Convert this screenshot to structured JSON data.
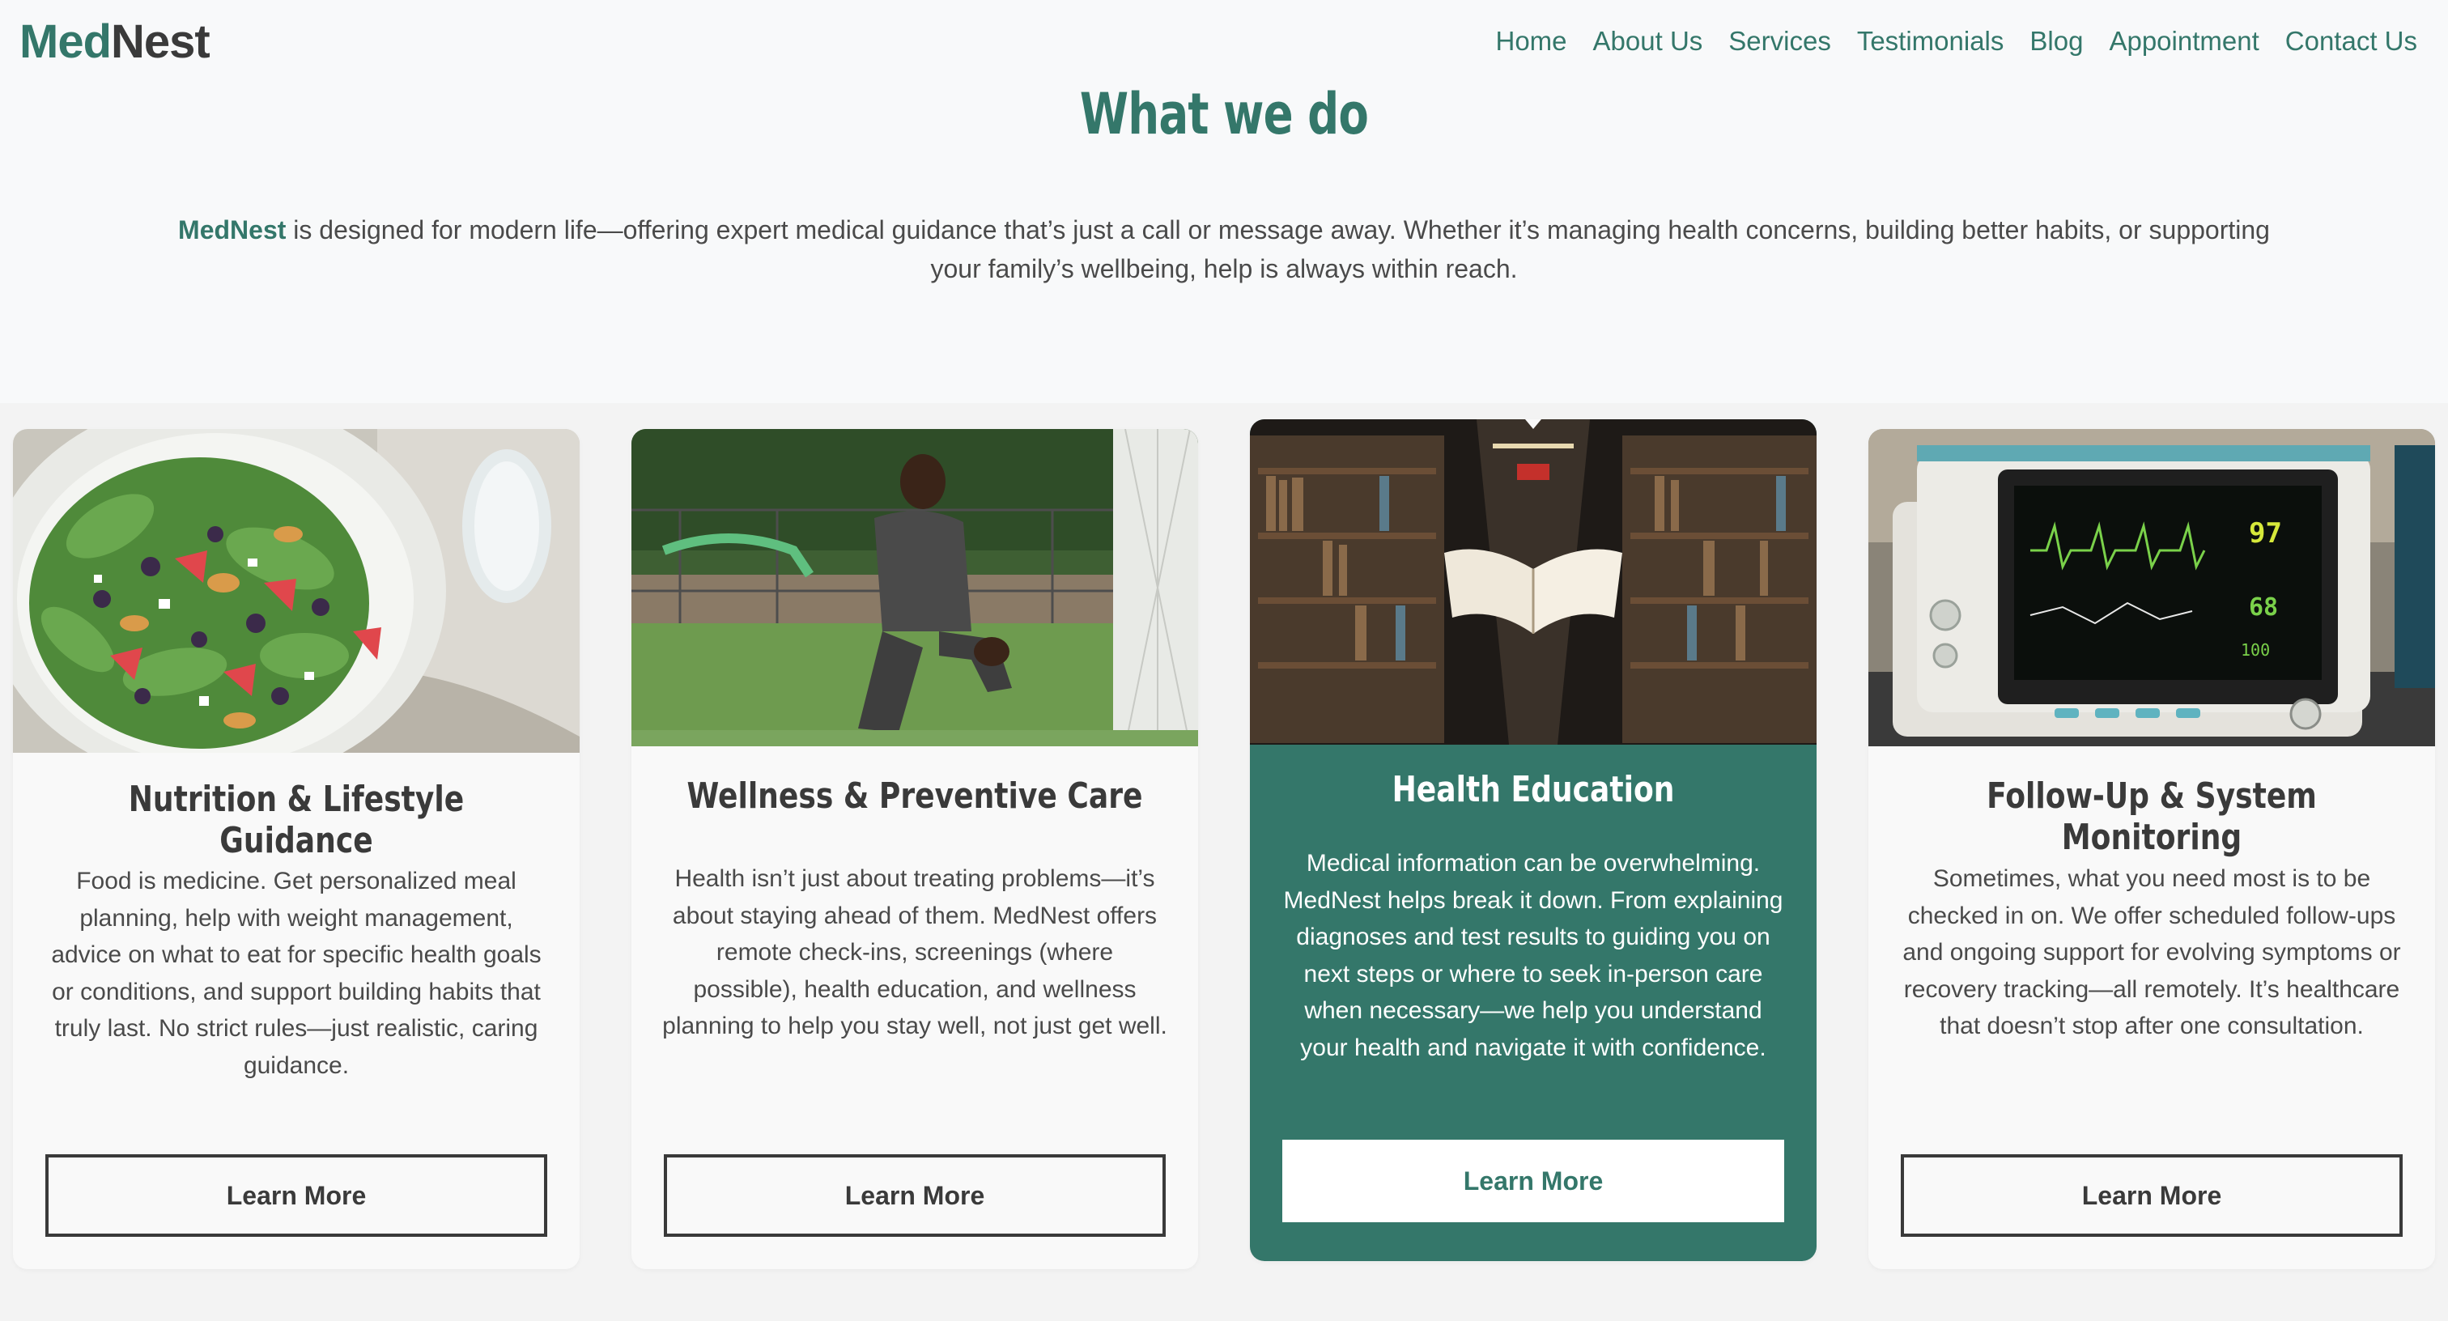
{
  "header": {
    "logo": {
      "part1": "Med",
      "part2": "Nest"
    },
    "nav": [
      "Home",
      "About Us",
      "Services",
      "Testimonials",
      "Blog",
      "Appointment",
      "Contact Us"
    ]
  },
  "intro": {
    "title": "What we do",
    "brand": "MedNest",
    "text": " is designed for modern life—offering expert medical guidance that’s just a call or message away. Whether it’s managing health concerns, building better habits, or supporting your family’s wellbeing, help is always within reach."
  },
  "cards": [
    {
      "title": "Nutrition & Lifestyle Guidance",
      "text": "Food is medicine. Get personalized meal planning, help with weight management, advice on what to eat for specific health goals or conditions, and support building habits that truly last. No strict rules—just realistic, caring guidance.",
      "button": "Learn More",
      "image": "salad-bowl-image"
    },
    {
      "title": "Wellness & Preventive Care",
      "text": "Health isn’t just about treating problems—it’s about staying ahead of them. MedNest offers remote check-ins, screenings (where possible), health education, and wellness planning to help you stay well, not just get well.",
      "button": "Learn More",
      "image": "man-stretching-image"
    },
    {
      "title": "Health Education",
      "text": "Medical information can be overwhelming. MedNest helps break it down. From explaining diagnoses and test results to guiding you on next steps or where to seek in-person care when necessary—we help you understand your health and navigate it with confidence.",
      "button": "Learn More",
      "image": "library-book-image"
    },
    {
      "title": "Follow-Up & System Monitoring",
      "text": "Sometimes, what you need most is to be checked in on. We offer scheduled follow-ups and ongoing support for evolving symptoms or recovery tracking—all remotely. It’s healthcare that doesn’t stop after one consultation.",
      "button": "Learn More",
      "image": "vital-monitor-image"
    }
  ],
  "colors": {
    "accent": "#34776a",
    "text": "#3a3a3a",
    "bg": "#f8f9fa"
  }
}
